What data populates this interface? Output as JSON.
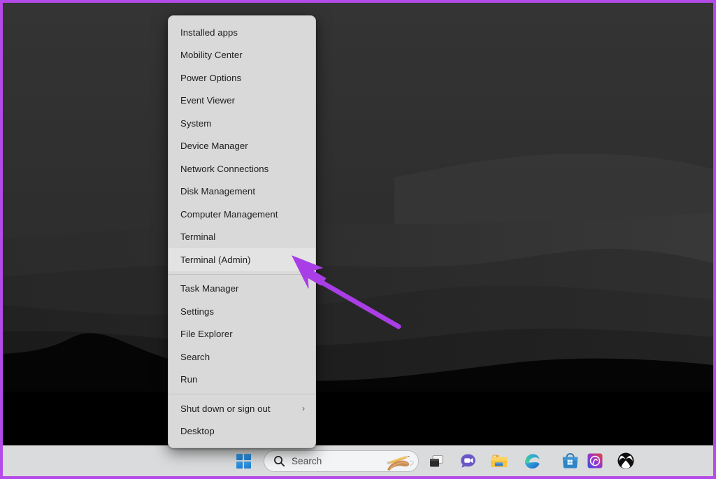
{
  "theme": {
    "frame_border_color": "#b44ae8",
    "menu_background": "#d9d9d9",
    "menu_text_color": "#1d1d1d",
    "menu_highlight": "#e3e3e3",
    "taskbar_background": "#d9dbdc",
    "annotation_arrow_color": "#a93ee6",
    "wallpaper_top": "#323232",
    "wallpaper_bottom": "#000000"
  },
  "context_menu": {
    "name": "Windows power user menu",
    "items": [
      {
        "label": "Installed apps",
        "type": "item",
        "selected": false
      },
      {
        "label": "Mobility Center",
        "type": "item",
        "selected": false
      },
      {
        "label": "Power Options",
        "type": "item",
        "selected": false
      },
      {
        "label": "Event Viewer",
        "type": "item",
        "selected": false
      },
      {
        "label": "System",
        "type": "item",
        "selected": false
      },
      {
        "label": "Device Manager",
        "type": "item",
        "selected": false
      },
      {
        "label": "Network Connections",
        "type": "item",
        "selected": false
      },
      {
        "label": "Disk Management",
        "type": "item",
        "selected": false
      },
      {
        "label": "Computer Management",
        "type": "item",
        "selected": false
      },
      {
        "label": "Terminal",
        "type": "item",
        "selected": false
      },
      {
        "label": "Terminal (Admin)",
        "type": "item",
        "selected": true
      },
      {
        "label": "",
        "type": "separator",
        "selected": false
      },
      {
        "label": "Task Manager",
        "type": "item",
        "selected": false
      },
      {
        "label": "Settings",
        "type": "item",
        "selected": false
      },
      {
        "label": "File Explorer",
        "type": "item",
        "selected": false
      },
      {
        "label": "Search",
        "type": "item",
        "selected": false
      },
      {
        "label": "Run",
        "type": "item",
        "selected": false
      },
      {
        "label": "",
        "type": "separator",
        "selected": false
      },
      {
        "label": "Shut down or sign out",
        "type": "submenu",
        "submenu_glyph": "›",
        "selected": false
      },
      {
        "label": "Desktop",
        "type": "item",
        "selected": false
      }
    ]
  },
  "taskbar": {
    "start": {
      "icon": "windows-logo-icon",
      "label": "Start"
    },
    "search": {
      "icon": "search-icon",
      "placeholder": "Search",
      "value": "Search",
      "decoration_icon": "hand-writing-pencil-icon"
    },
    "pinned": [
      {
        "name": "task-view",
        "label": "Task View",
        "icon": "task-view-icon"
      },
      {
        "name": "chat",
        "label": "Chat",
        "icon": "chat-bubble-icon"
      },
      {
        "name": "file-explorer",
        "label": "File Explorer",
        "icon": "folder-icon"
      },
      {
        "name": "edge",
        "label": "Microsoft Edge",
        "icon": "edge-icon"
      },
      {
        "name": "microsoft-store",
        "label": "Microsoft Store",
        "icon": "store-bag-icon"
      },
      {
        "name": "copilot",
        "label": "Copilot",
        "icon": "copilot-icon"
      },
      {
        "name": "xbox",
        "label": "Xbox",
        "icon": "xbox-icon"
      }
    ]
  },
  "annotation": {
    "type": "arrow",
    "points_to": "Terminal (Admin)",
    "color": "#a93ee6"
  }
}
